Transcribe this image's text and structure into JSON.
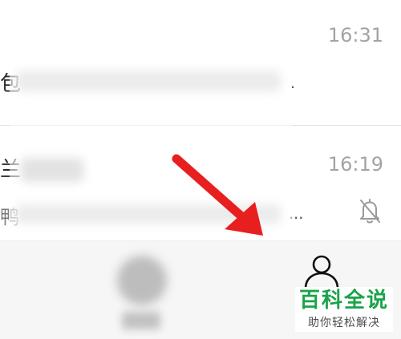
{
  "chat_list": {
    "items": [
      {
        "time": "16:31",
        "left_fragment": "包",
        "ellipsis": "."
      },
      {
        "time": "16:19",
        "left_fragment": "兰",
        "left_fragment_2": "鸭",
        "ellipsis": "..."
      }
    ]
  },
  "watermark": {
    "title": "百科全说",
    "subtitle": "助你轻松解决"
  },
  "colors": {
    "arrow": "#e81f1f",
    "watermark_green": "#1aa34a",
    "time_gray": "#a3a3a3",
    "tab_bar_bg": "#f6f6f6"
  },
  "icons": {
    "muted_notification": "bell-slash-icon",
    "contacts_tab": "person-outline-icon"
  }
}
